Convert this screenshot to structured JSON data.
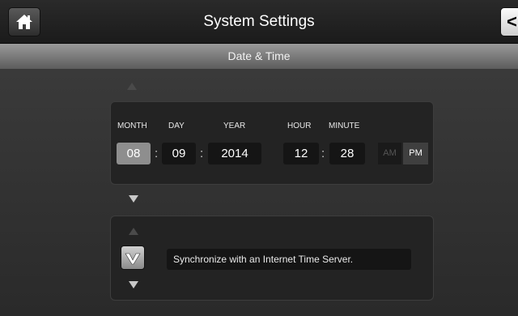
{
  "header": {
    "title": "System Settings",
    "back_label": "<"
  },
  "section_title": "Date & Time",
  "datetime": {
    "labels": {
      "month": "MONTH",
      "day": "DAY",
      "year": "YEAR",
      "hour": "HOUR",
      "minute": "MINUTE"
    },
    "month": "08",
    "day": "09",
    "year": "2014",
    "hour": "12",
    "minute": "28",
    "date_separator": ":",
    "time_separator": ":",
    "am_label": "AM",
    "pm_label": "PM",
    "selected_period": "PM"
  },
  "sync": {
    "label": "Synchronize with an Internet Time Server.",
    "checked": true
  },
  "icons": {
    "home": "home-icon",
    "check": "check-icon",
    "up": "chevron-up-icon",
    "down": "chevron-down-icon"
  },
  "colors": {
    "accent_selected": "#8e8e8e",
    "field_bg": "#151515"
  }
}
